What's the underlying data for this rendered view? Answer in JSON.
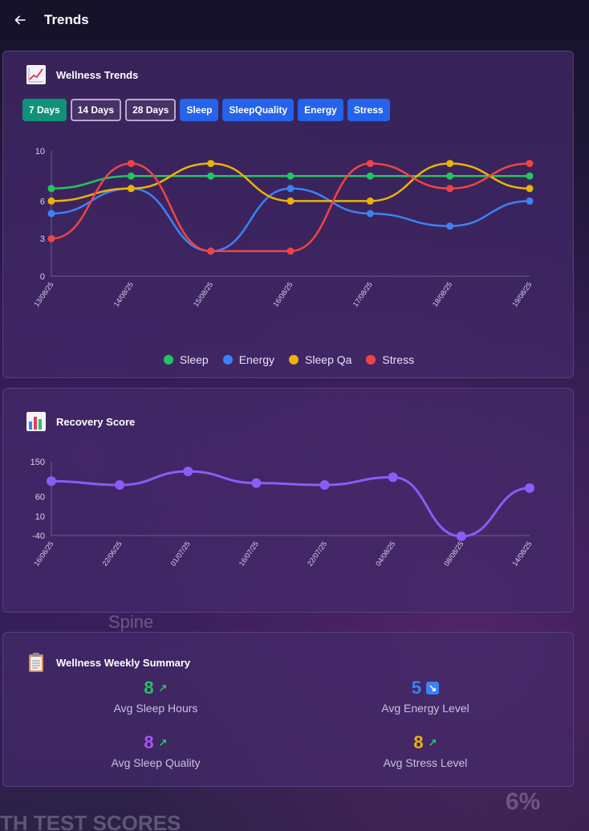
{
  "header": {
    "title": "Trends"
  },
  "background": {
    "spine": "Spine",
    "scores": "TH TEST SCORES",
    "percent": "6%"
  },
  "wellness": {
    "title": "Wellness Trends",
    "filters": [
      "7 Days",
      "14 Days",
      "28 Days"
    ],
    "metrics": [
      "Sleep",
      "SleepQuality",
      "Energy",
      "Stress"
    ],
    "legend": [
      "Sleep",
      "Energy",
      "Sleep Qa",
      "Stress"
    ]
  },
  "recovery": {
    "title": "Recovery Score"
  },
  "summary": {
    "title": "Wellness Weekly Summary",
    "stats": [
      {
        "value": "8",
        "label": "Avg Sleep Hours",
        "color": "#22c55e",
        "trend": "up"
      },
      {
        "value": "5",
        "label": "Avg Energy Level",
        "color": "#3b82f6",
        "trend": "down-box"
      },
      {
        "value": "8",
        "label": "Avg Sleep Quality",
        "color": "#a855f7",
        "trend": "up"
      },
      {
        "value": "8",
        "label": "Avg Stress Level",
        "color": "#eab308",
        "trend": "up"
      }
    ]
  },
  "chart_data": [
    {
      "type": "line",
      "title": "Wellness Trends",
      "x": [
        "13/08/25",
        "14/08/25",
        "15/08/25",
        "16/08/25",
        "17/08/25",
        "18/08/25",
        "19/08/25"
      ],
      "yticks": [
        0,
        3,
        6,
        10
      ],
      "ylim": [
        0,
        10
      ],
      "series": [
        {
          "name": "Sleep",
          "color": "#22c55e",
          "values": [
            7,
            8,
            8,
            8,
            8,
            8,
            8
          ]
        },
        {
          "name": "Energy",
          "color": "#3b82f6",
          "values": [
            5,
            7,
            2,
            7,
            5,
            4,
            6
          ]
        },
        {
          "name": "Sleep Qa",
          "color": "#eab308",
          "values": [
            6,
            7,
            9,
            6,
            6,
            9,
            7
          ]
        },
        {
          "name": "Stress",
          "color": "#ef4444",
          "values": [
            3,
            9,
            2,
            2,
            9,
            7,
            9
          ]
        }
      ],
      "legend": "bottom"
    },
    {
      "type": "line",
      "title": "Recovery Score",
      "x": [
        "16/06/25",
        "22/06/25",
        "01/07/25",
        "16/07/25",
        "22/07/25",
        "04/08/25",
        "08/08/25",
        "14/08/25"
      ],
      "yticks": [
        -40,
        10,
        60,
        150
      ],
      "ylim": [
        -40,
        150
      ],
      "series": [
        {
          "name": "",
          "color": "#8b5cf6",
          "values": [
            100,
            90,
            125,
            95,
            90,
            110,
            -42,
            82
          ]
        }
      ]
    }
  ]
}
